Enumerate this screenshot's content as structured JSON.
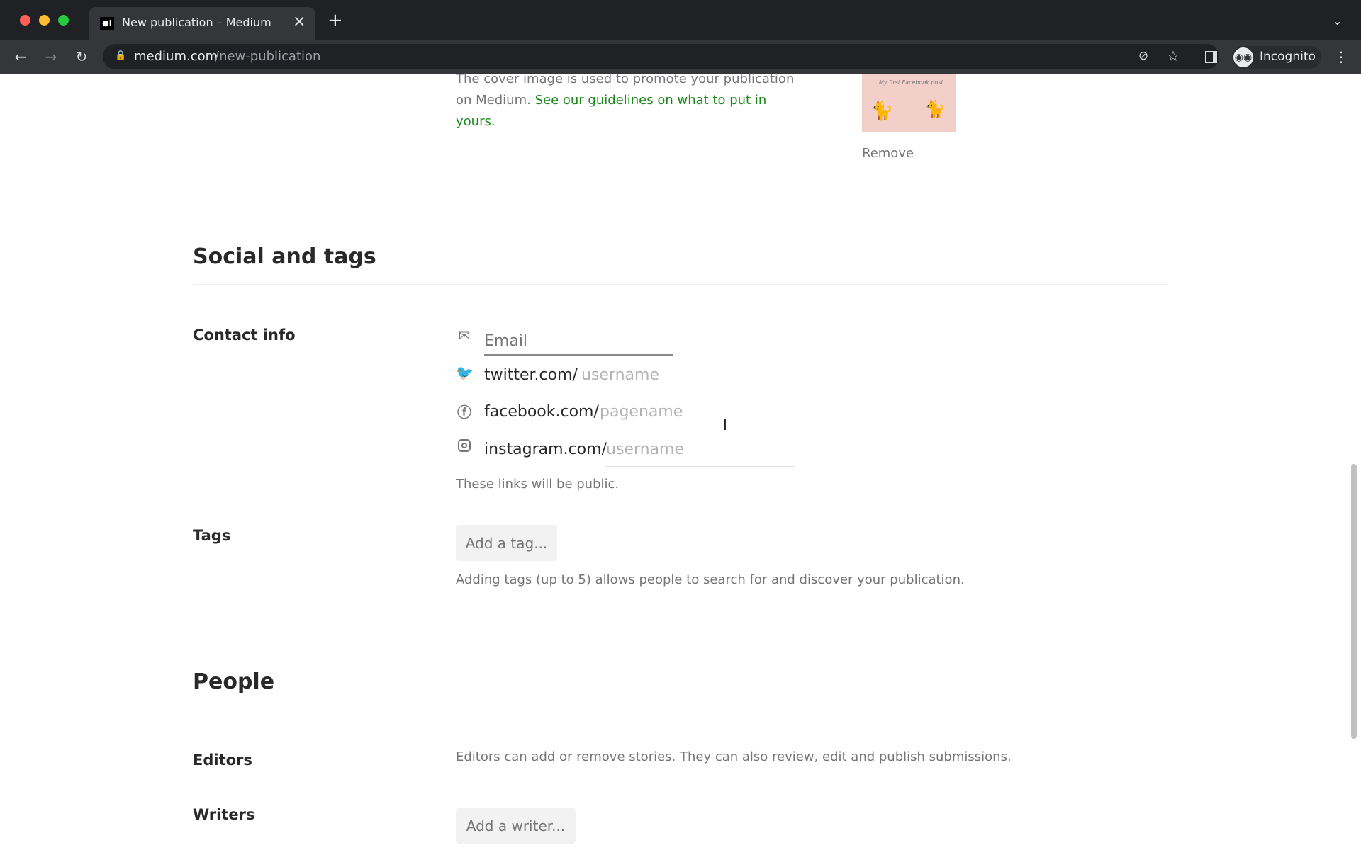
{
  "browser": {
    "tab_title": "New publication – Medium",
    "url_domain": "medium.com",
    "url_path": "/new-publication",
    "profile": "Incognito",
    "new_tab": "+",
    "close_tab": "×"
  },
  "cover": {
    "description": "The cover image is used to promote your publication on Medium.",
    "guidelines_link": "See our guidelines on what to put in yours.",
    "image_caption": "My first Facebook post",
    "remove": "Remove",
    "link_color": "#1a8917"
  },
  "social": {
    "heading": "Social and tags",
    "contact_label": "Contact info",
    "email_placeholder": "Email",
    "twitter_prefix": "twitter.com/",
    "twitter_placeholder": "username",
    "facebook_prefix": "facebook.com/",
    "facebook_placeholder": "pagename",
    "instagram_prefix": "instagram.com/",
    "instagram_placeholder": "username",
    "links_note": "These links will be public.",
    "tags_label": "Tags",
    "add_tag": "Add a tag...",
    "tags_note": "Adding tags (up to 5) allows people to search for and discover your publication."
  },
  "people": {
    "heading": "People",
    "editors_label": "Editors",
    "editors_note": "Editors can add or remove stories. They can also review, edit and publish submissions.",
    "writers_label": "Writers",
    "add_writer": "Add a writer..."
  }
}
